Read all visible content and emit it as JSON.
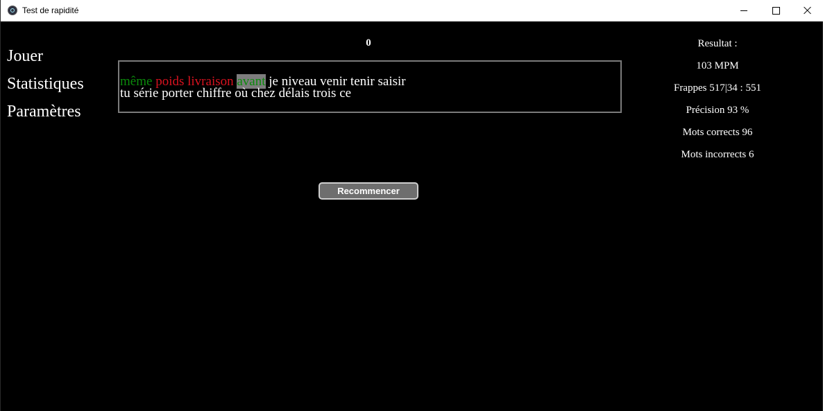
{
  "window": {
    "title": "Test de rapidité"
  },
  "menu": {
    "items": [
      "Jouer",
      "Statistiques",
      "Paramètres"
    ]
  },
  "timer": "0",
  "words": {
    "line1": [
      {
        "text": "même",
        "state": "correct"
      },
      {
        "text": "poids",
        "state": "wrong"
      },
      {
        "text": "livraison",
        "state": "wrong"
      },
      {
        "text": "avant",
        "state": "current"
      },
      {
        "text": "je niveau venir tenir saisir",
        "state": "pending"
      }
    ],
    "line2": "tu série porter chiffre où chez délais trois ce"
  },
  "results": {
    "heading": "Resultat :",
    "wpm": "103 MPM",
    "keystrokes": "Frappes 517|34 : 551",
    "accuracy": "Précision 93 %",
    "correct_words": "Mots corrects 96",
    "incorrect_words": "Mots incorrects 6"
  },
  "restart_label": "Recommencer",
  "colors": {
    "correct": "#0b8a0b",
    "wrong": "#d9121f",
    "current_bg": "#7d7d7d",
    "button": "#6e6e6e"
  },
  "icons": {
    "app": "electron-app-icon",
    "minimize": "minimize-icon",
    "maximize": "maximize-icon",
    "close": "close-icon"
  }
}
